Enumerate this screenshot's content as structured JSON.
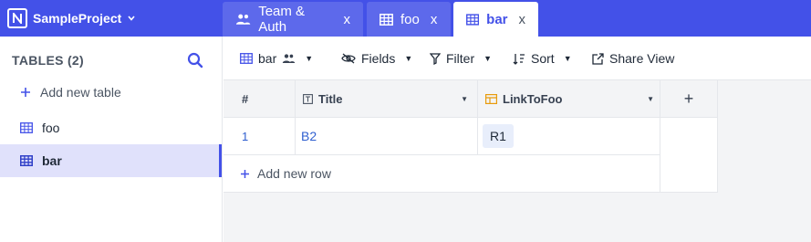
{
  "project": {
    "name": "SampleProject"
  },
  "tabs": [
    {
      "label": "Team & Auth",
      "close": "x"
    },
    {
      "label": "foo",
      "close": "x"
    },
    {
      "label": "bar",
      "close": "x"
    }
  ],
  "sidebar": {
    "header": "TABLES (2)",
    "add_label": "Add new table",
    "items": [
      {
        "label": "foo"
      },
      {
        "label": "bar"
      }
    ]
  },
  "toolbar": {
    "view_name": "bar",
    "fields_label": "Fields",
    "filter_label": "Filter",
    "sort_label": "Sort",
    "share_label": "Share View"
  },
  "grid": {
    "columns": [
      {
        "label": "#"
      },
      {
        "label": "Title"
      },
      {
        "label": "LinkToFoo"
      },
      {
        "label": "+"
      }
    ],
    "rows": [
      {
        "num": "1",
        "title": "B2",
        "link": "R1"
      }
    ],
    "add_row_label": "Add new row"
  },
  "colors": {
    "accent": "#4351e8",
    "link_text": "#2f5fd0",
    "active_row": "#e0e1fb"
  }
}
